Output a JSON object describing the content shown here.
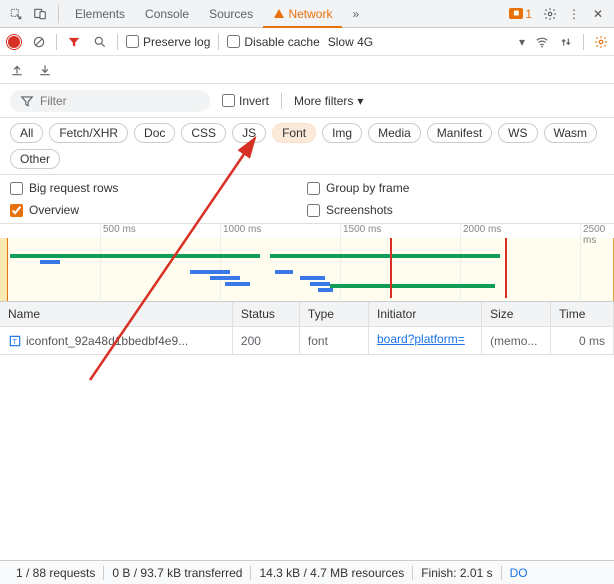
{
  "topTabs": {
    "elements": "Elements",
    "console": "Console",
    "sources": "Sources",
    "network": "Network",
    "more": "»",
    "issues_count": "1"
  },
  "toolbar": {
    "preserve_log": "Preserve log",
    "disable_cache": "Disable cache",
    "throttle": "Slow 4G"
  },
  "filter": {
    "placeholder": "Filter",
    "invert": "Invert",
    "more_filters": "More filters"
  },
  "chips": {
    "all": "All",
    "fetch": "Fetch/XHR",
    "doc": "Doc",
    "css": "CSS",
    "js": "JS",
    "font": "Font",
    "img": "Img",
    "media": "Media",
    "manifest": "Manifest",
    "ws": "WS",
    "wasm": "Wasm",
    "other": "Other"
  },
  "options": {
    "big_rows": "Big request rows",
    "overview": "Overview",
    "group_frame": "Group by frame",
    "screenshots": "Screenshots"
  },
  "timeline": {
    "ticks": [
      "500 ms",
      "1000 ms",
      "1500 ms",
      "2000 ms",
      "2500 ms"
    ]
  },
  "columns": {
    "name": "Name",
    "status": "Status",
    "type": "Type",
    "initiator": "Initiator",
    "size": "Size",
    "time": "Time"
  },
  "rows": [
    {
      "name": "iconfont_92a48d1bbedbf4e9...",
      "status": "200",
      "type": "font",
      "initiator": "board?platform=",
      "size": "(memo...",
      "time": "0 ms"
    }
  ],
  "statusbar": {
    "requests": "1 / 88 requests",
    "transferred": "0 B / 93.7 kB transferred",
    "resources": "14.3 kB / 4.7 MB resources",
    "finish": "Finish: 2.01 s",
    "dom": "DO"
  }
}
